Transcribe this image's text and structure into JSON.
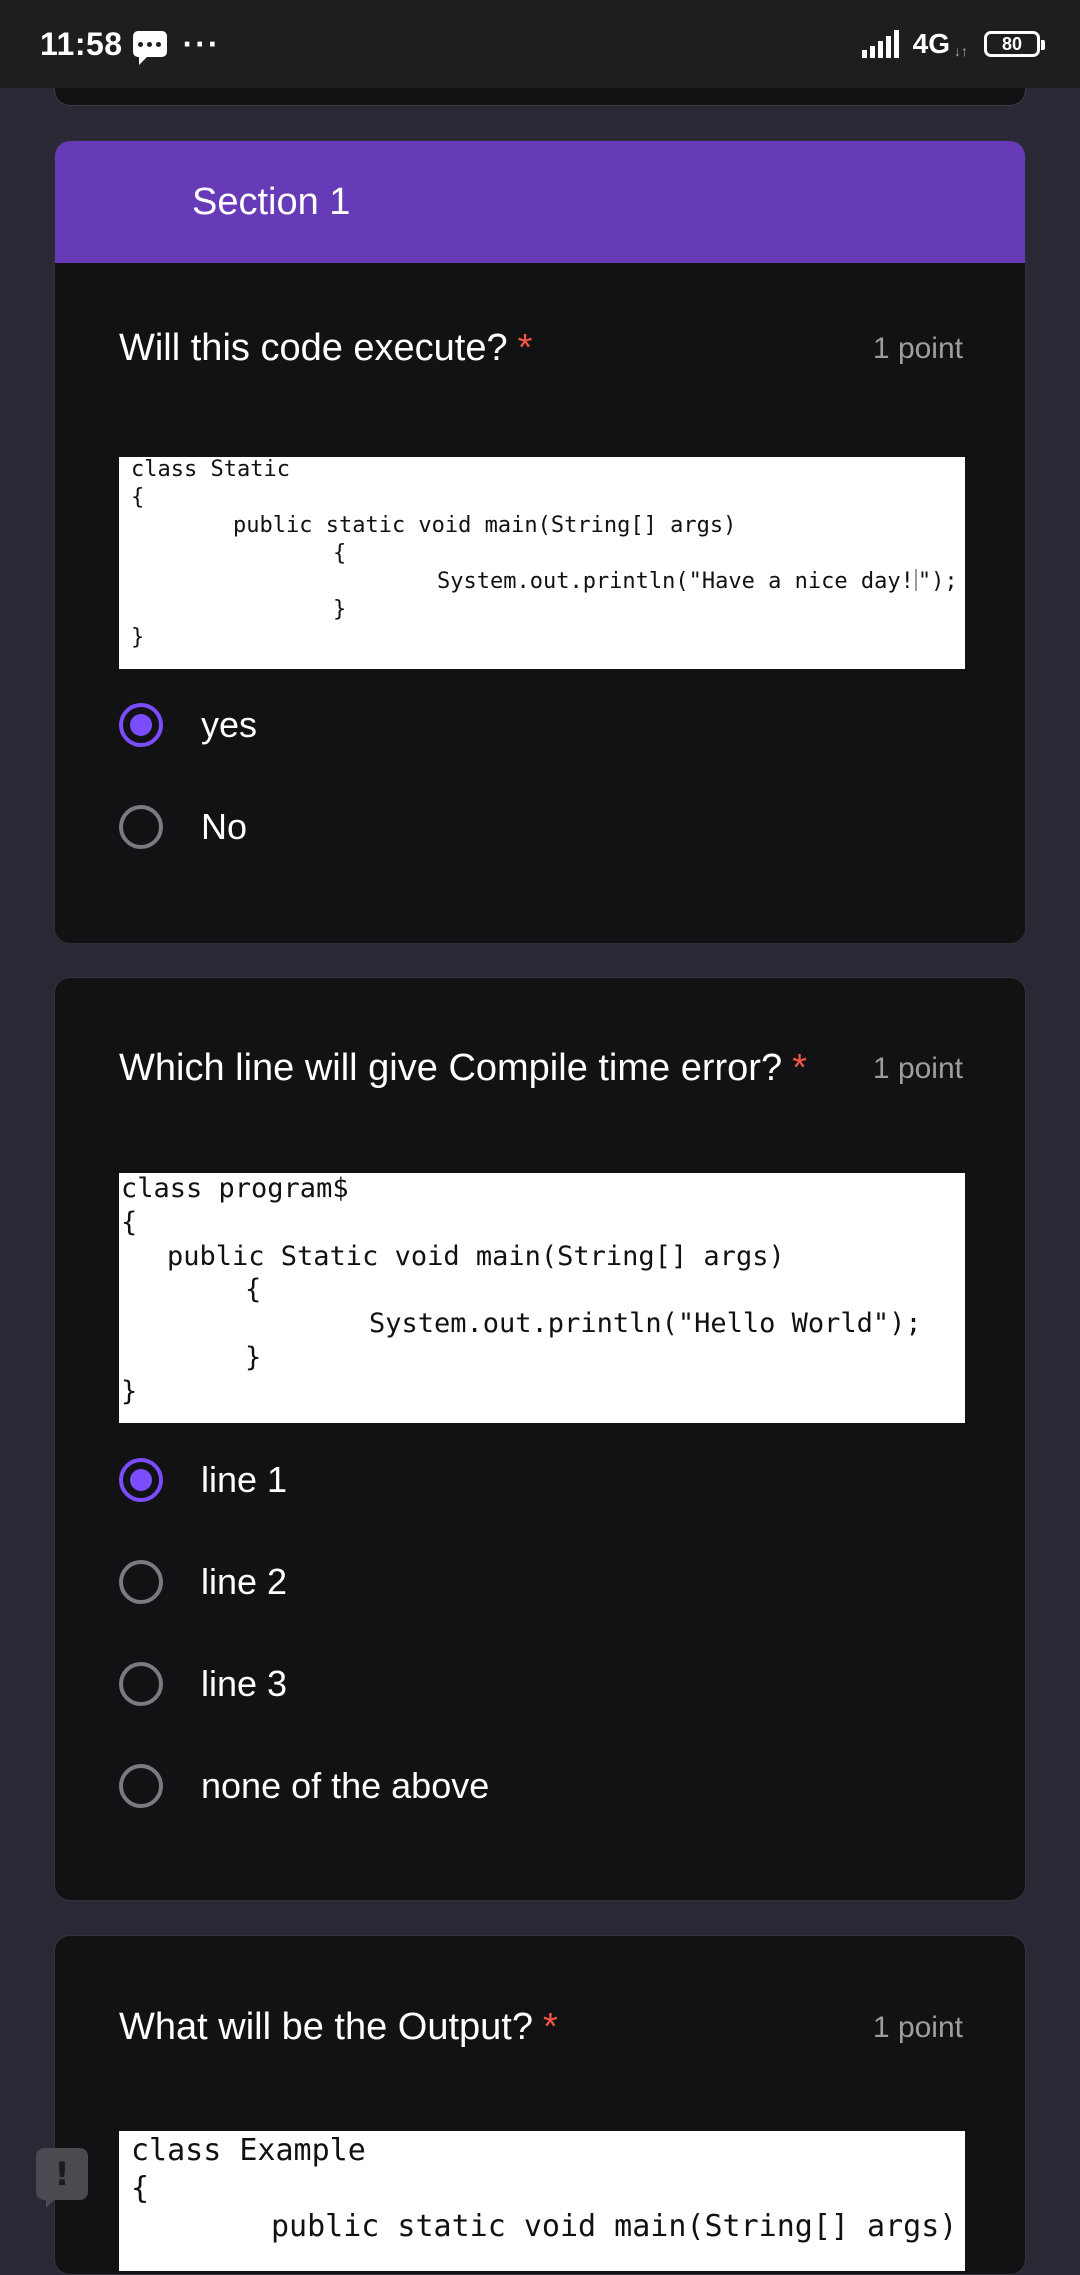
{
  "status_bar": {
    "time": "11:58",
    "network": "4G",
    "battery": "80"
  },
  "section": {
    "title": "Section 1"
  },
  "questions": [
    {
      "title": "Will this code execute?",
      "required_mark": "*",
      "points": "1 point",
      "code": [
        "class Static",
        "{",
        "public static void main(String[] args)",
        "{",
        "System.out.println(\"Have a nice day!",
        "\");",
        "}",
        "}"
      ],
      "options": [
        {
          "label": "yes",
          "selected": true
        },
        {
          "label": "No",
          "selected": false
        }
      ]
    },
    {
      "title": "Which line will give Compile time error?",
      "required_mark": "*",
      "points": "1 point",
      "code": [
        "class program$",
        "{",
        "public Static void main(String[] args)",
        "{",
        "System.out.println(\"Hello World\");",
        "}",
        "}"
      ],
      "options": [
        {
          "label": "line 1",
          "selected": true
        },
        {
          "label": "line 2",
          "selected": false
        },
        {
          "label": "line 3",
          "selected": false
        },
        {
          "label": "none of the above",
          "selected": false
        }
      ]
    },
    {
      "title": "What will be the Output?",
      "required_mark": "*",
      "points": "1 point",
      "code": [
        "class Example",
        "{",
        "public static void main(String[] args)"
      ]
    }
  ],
  "feedback": {
    "mark": "!"
  },
  "colors": {
    "accent": "#673ab7",
    "radio": "#7c4dff",
    "required": "#f05545"
  }
}
